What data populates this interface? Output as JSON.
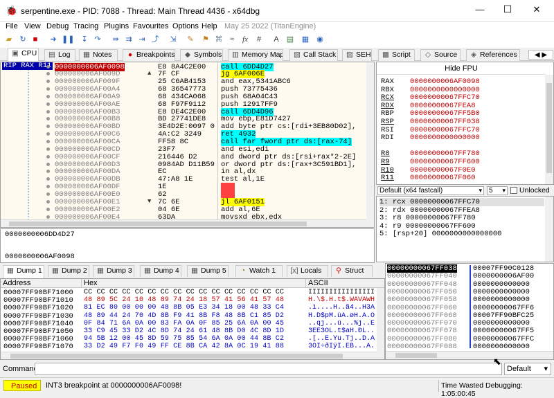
{
  "window": {
    "title": "serpentine.exe - PID: 7088 - Thread: Main Thread 4436 - x64dbg",
    "minimize": "—",
    "maximize": "☐",
    "close": "✕"
  },
  "menu": [
    "File",
    "View",
    "Debug",
    "Tracing",
    "Plugins",
    "Favourites",
    "Options",
    "Help",
    "May 25 2022 (TitanEngine)"
  ],
  "tabs": [
    {
      "icon": "cpu-icon",
      "glyph": "▣",
      "label": "CPU"
    },
    {
      "icon": "log-icon",
      "glyph": "▤",
      "label": "Log"
    },
    {
      "icon": "notes-icon",
      "glyph": "▦",
      "label": "Notes"
    },
    {
      "icon": "breakpoint-icon",
      "glyph": "●",
      "label": "Breakpoints"
    },
    {
      "icon": "symbols-icon",
      "glyph": "◆",
      "label": "Symbols"
    },
    {
      "icon": "memory-map-icon",
      "glyph": "▥",
      "label": "Memory Map"
    },
    {
      "icon": "call-stack-icon",
      "glyph": "▧",
      "label": "Call Stack"
    },
    {
      "icon": "seh-icon",
      "glyph": "▨",
      "label": "SEH"
    },
    {
      "icon": "script-icon",
      "glyph": "▩",
      "label": "Script"
    },
    {
      "icon": "source-icon",
      "glyph": "◇",
      "label": "Source"
    },
    {
      "icon": "references-icon",
      "glyph": "◈",
      "label": "References"
    }
  ],
  "cpu": {
    "rip_label": "RIP RAX R11",
    "rows": [
      {
        "addr": "0000000006AF0098",
        "bytes": "E8 8A4C2E00",
        "ins": "call 6DD4D27",
        "hl": "cyan",
        "selected": true,
        "arrow": ""
      },
      {
        "addr": "000000006AF009D",
        "bytes": "7F CF",
        "ins": "jg 6AF006E",
        "hl": "yellow",
        "arrow": "^"
      },
      {
        "addr": "000000006AF009F",
        "bytes": "25 C6AB4153",
        "ins": "and eax,5341ABC6"
      },
      {
        "addr": "000000006AF00A4",
        "bytes": "68 36547773",
        "ins": "push 73775436"
      },
      {
        "addr": "000000006AF00A9",
        "bytes": "68 434CA068",
        "ins": "push 68A04C43"
      },
      {
        "addr": "000000006AF00AE",
        "bytes": "68 F97F9112",
        "ins": "push 12917FF9"
      },
      {
        "addr": "000000006AF00B3",
        "bytes": "E8 DE4C2E00",
        "ins": "call 6DD4D96",
        "hl": "cyan"
      },
      {
        "addr": "000000006AF00B8",
        "bytes": "BD 27741DE8",
        "ins": "mov ebp,E81D7427"
      },
      {
        "addr": "000000006AF00BD",
        "bytes": "3E4D2E:0097 0",
        "ins": "add byte ptr cs:[rdi+3EB80D02],"
      },
      {
        "addr": "000000006AF00C6",
        "bytes": "4A:C2 3249",
        "ins": "ret 4932",
        "hl": "cyan"
      },
      {
        "addr": "000000006AF00CA",
        "bytes": "FF58 8C",
        "ins": "call far fword ptr ds:[rax-74]",
        "hl": "cyan"
      },
      {
        "addr": "000000006AF00CD",
        "bytes": "23F7",
        "ins": "and esi,edi"
      },
      {
        "addr": "000000006AF00CF",
        "bytes": "216446 D2",
        "ins": "and dword ptr ds:[rsi+rax*2-2E]"
      },
      {
        "addr": "000000006AF00D3",
        "bytes": "0984AD D11B59",
        "ins": "or dword ptr ds:[rax+3C591BD1],"
      },
      {
        "addr": "000000006AF00DA",
        "bytes": "EC",
        "ins": "in al,dx"
      },
      {
        "addr": "000000006AF00DB",
        "bytes": "47:A8 1E",
        "ins": "test al,1E"
      },
      {
        "addr": "000000006AF00DF",
        "bytes": "1E",
        "ins": "???",
        "hl": "red"
      },
      {
        "addr": "000000006AF00E0",
        "bytes": "62",
        "ins": "???",
        "hl": "red"
      },
      {
        "addr": "000000006AF00E1",
        "bytes": "7C 6E",
        "ins": "jl 6AF0151",
        "hl": "yellow",
        "arrow": "v"
      },
      {
        "addr": "000000006AF00E2",
        "bytes": "04 6E",
        "ins": "add al,6E"
      },
      {
        "addr": "000000006AF00E4",
        "bytes": "63DA",
        "ins": "movsxd ebx,edx"
      }
    ]
  },
  "info": {
    "line1": "0000000006DD4D27",
    "line2": "0000000006AF0098"
  },
  "registers": {
    "header": "Hide FPU",
    "rows": [
      {
        "name": "RAX",
        "value": "0000000006AF0098",
        "color": "red"
      },
      {
        "name": "RBX",
        "value": "0000000000000000",
        "color": "red"
      },
      {
        "name": "RCX",
        "value": "00000000067FFC70",
        "color": "red",
        "underline": true
      },
      {
        "name": "RDX",
        "value": "00000000067FEA8",
        "color": "red",
        "underline": true
      },
      {
        "name": "RBP",
        "value": "00000000067FF5B0",
        "color": "red"
      },
      {
        "name": "RSP",
        "value": "00000000067FF038",
        "color": "red",
        "underline": true
      },
      {
        "name": "RSI",
        "value": "00000000067FFC70",
        "color": "red"
      },
      {
        "name": "RDI",
        "value": "0000000000000000",
        "color": "red"
      },
      {
        "name": "",
        "value": ""
      },
      {
        "name": "R8",
        "value": "00000000067FF780",
        "color": "red",
        "underline": true
      },
      {
        "name": "R9",
        "value": "00000000067FF600",
        "color": "red",
        "underline": true
      },
      {
        "name": "R10",
        "value": "00000000067F0E0",
        "color": "red",
        "underline": true
      },
      {
        "name": "R11",
        "value": "00000000067F060",
        "color": "red",
        "underline": true
      }
    ]
  },
  "callconv": {
    "selected": "Default (x64 fastcall)",
    "count": "5",
    "unlocked_label": "Unlocked",
    "args": [
      "1: rcx 00000000067FFC70",
      "2: rdx 00000000067FFEA8",
      "3: r8 00000000067FF780",
      "4: r9 00000000067FF600",
      "5: [rsp+20] 0000000000000000"
    ]
  },
  "dump_tabs": [
    {
      "label": "Dump 1",
      "icon": "dump-icon"
    },
    {
      "label": "Dump 2",
      "icon": "dump-icon"
    },
    {
      "label": "Dump 3",
      "icon": "dump-icon"
    },
    {
      "label": "Dump 4",
      "icon": "dump-icon"
    },
    {
      "label": "Dump 5",
      "icon": "dump-icon"
    },
    {
      "label": "Watch 1",
      "icon": "watch-icon"
    },
    {
      "label": "Locals",
      "icon": "locals-icon"
    },
    {
      "label": "Struct",
      "icon": "struct-icon"
    }
  ],
  "dump": {
    "col_address": "Address",
    "col_hex": "Hex",
    "col_ascii": "ASCII",
    "rows": [
      {
        "addr": "00007FF90BF71000",
        "hex": "CC CC CC CC CC CC CC CC CC CC CC CC CC CC CC CC",
        "ascii": "ÌÌÌÌÌÌÌÌÌÌÌÌÌÌÌÌ",
        "color": "black"
      },
      {
        "addr": "00007FF90BF71010",
        "hex": "48 89 5C 24 10 48 89 74 24 18 57 41 56 41 57 48",
        "ascii": "H.\\$.H.t$.WAVAWH",
        "color": "red"
      },
      {
        "addr": "00007FF90BF71020",
        "hex": "81 EC 80 00 00 00 48 8B 05 E3 34 18 00 48 33 C4",
        "ascii": ".ì....H..ã4..H3Ä",
        "color": "blue"
      },
      {
        "addr": "00007FF90BF71030",
        "hex": "48 89 44 24 70 4D 8B F9 41 8B F8 48 8B C1 85 D2",
        "ascii": "H.D$pM.ùA.øH.Á.Ò",
        "color": "blue"
      },
      {
        "addr": "00007FF90BF71040",
        "hex": "0F 84 71 6A 0A 00 83 FA 0A 0F 85 25 6A 0A 00 45",
        "ascii": "..qj...ú...%j..E",
        "color": "blue"
      },
      {
        "addr": "00007FF90BF71050",
        "hex": "33 C9 45 33 D2 4C 8D 74 24 61 48 8B D0 4C 8D 1D",
        "ascii": "3ÉE3ÒL.t$aH.ÐL..",
        "color": "blue"
      },
      {
        "addr": "00007FF90BF71060",
        "hex": "94 5B 12 00 45 8D 59 75 85 54 6A 0A 00 44 8B C2",
        "ascii": ".[..E.Yu.Tj..D.Â",
        "color": "blue"
      },
      {
        "addr": "00007FF90BF71070",
        "hex": "33 D2 49 F7 F0 49 FF CE 8B CA 42 8A 0C 19 41 88",
        "ascii": "3ÒI÷ðIÿÎ.ÊB...A.",
        "color": "blue"
      }
    ]
  },
  "stack": {
    "rows": [
      {
        "addr": "00000000067FF038",
        "val": "00007FF90C0128",
        "selected": true
      },
      {
        "addr": "00000000067FF040",
        "val": "0000000006AF00"
      },
      {
        "addr": "00000000067FF048",
        "val": "0000000000000"
      },
      {
        "addr": "00000000067FF050",
        "val": "0000000000000"
      },
      {
        "addr": "00000000067FF058",
        "val": "0000000000000"
      },
      {
        "addr": "00000000067FF060",
        "val": "00000000067FF6"
      },
      {
        "addr": "00000000067FF068",
        "val": "00007FF90BFC25"
      },
      {
        "addr": "00000000067FF070",
        "val": "0000000000000"
      },
      {
        "addr": "00000000067FF078",
        "val": "00000000067FF5"
      },
      {
        "addr": "00000000067FF080",
        "val": "00000000067FFC"
      },
      {
        "addr": "00000000067FF088",
        "val": "0000000000000"
      }
    ]
  },
  "command": {
    "label": "Command:",
    "value": "",
    "mode": "Default"
  },
  "status": {
    "state": "Paused",
    "message": "INT3 breakpoint at 0000000006AF0098!",
    "time": "Time Wasted Debugging: 1:05:00:45"
  },
  "colors": {
    "accent_blue": "#0000ff",
    "register_red": "#c00000",
    "cyan_call": "#00ffff",
    "yellow_jump": "#ffff00",
    "paused_bg": "#ffff00",
    "selected_row": "#0000aa"
  }
}
